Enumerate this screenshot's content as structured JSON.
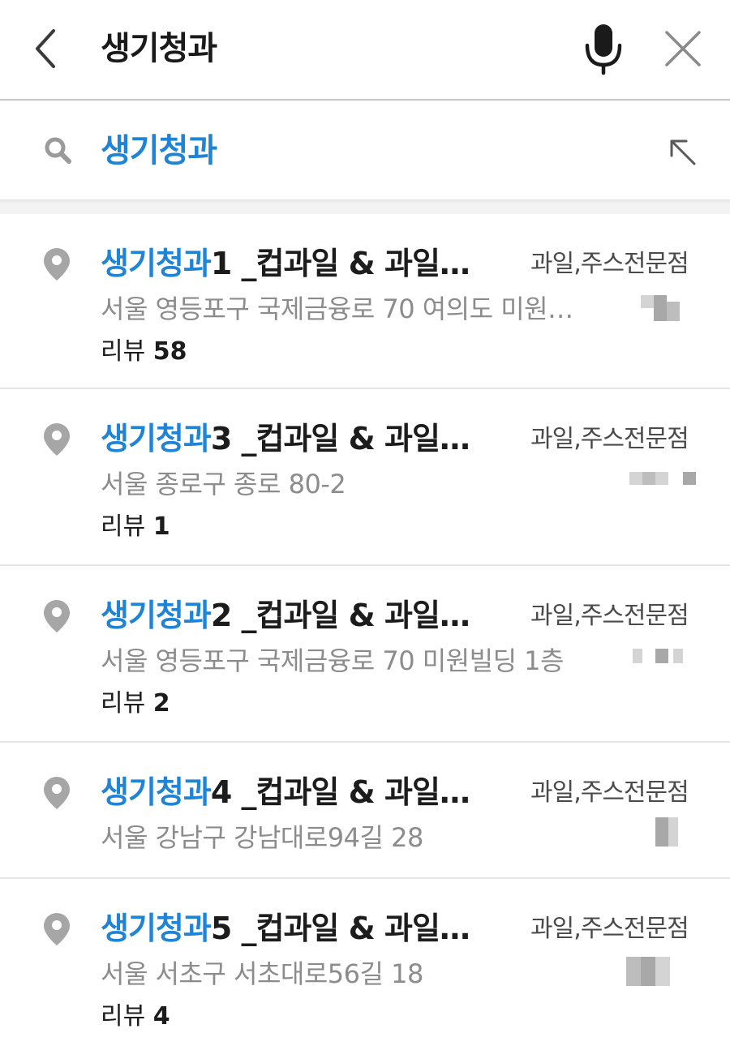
{
  "header": {
    "query": "생기청과"
  },
  "suggestion": {
    "text": "생기청과"
  },
  "results": [
    {
      "title_highlight": "생기청과",
      "title_rest": "1 _컵과일 & 과일…",
      "category": "과일,주스전문점",
      "address": "서울 영등포구 국제금융로 70 여의도 미원…",
      "review_label": "리뷰",
      "review_count": "58"
    },
    {
      "title_highlight": "생기청과",
      "title_rest": "3 _컵과일 & 과일…",
      "category": "과일,주스전문점",
      "address": "서울 종로구 종로 80-2",
      "review_label": "리뷰",
      "review_count": "1"
    },
    {
      "title_highlight": "생기청과",
      "title_rest": "2 _컵과일 & 과일…",
      "category": "과일,주스전문점",
      "address": "서울 영등포구 국제금융로 70 미원빌딩 1층",
      "review_label": "리뷰",
      "review_count": "2"
    },
    {
      "title_highlight": "생기청과",
      "title_rest": "4 _컵과일 & 과일…",
      "category": "과일,주스전문점",
      "address": "서울 강남구 강남대로94길 28",
      "review_label": "",
      "review_count": ""
    },
    {
      "title_highlight": "생기청과",
      "title_rest": "5 _컵과일 & 과일…",
      "category": "과일,주스전문점",
      "address": "서울 서초구 서초대로56길 18",
      "review_label": "리뷰",
      "review_count": "4"
    }
  ],
  "colors": {
    "highlight": "#1f84d6",
    "text": "#1c1c1c",
    "muted": "#8c8c8c",
    "icon": "#9a9a9a"
  },
  "icons": {
    "back": "chevron-left-icon",
    "mic": "microphone-icon",
    "clear": "close-icon",
    "search": "search-icon",
    "fill": "arrow-up-left-icon",
    "place": "map-pin-icon"
  }
}
